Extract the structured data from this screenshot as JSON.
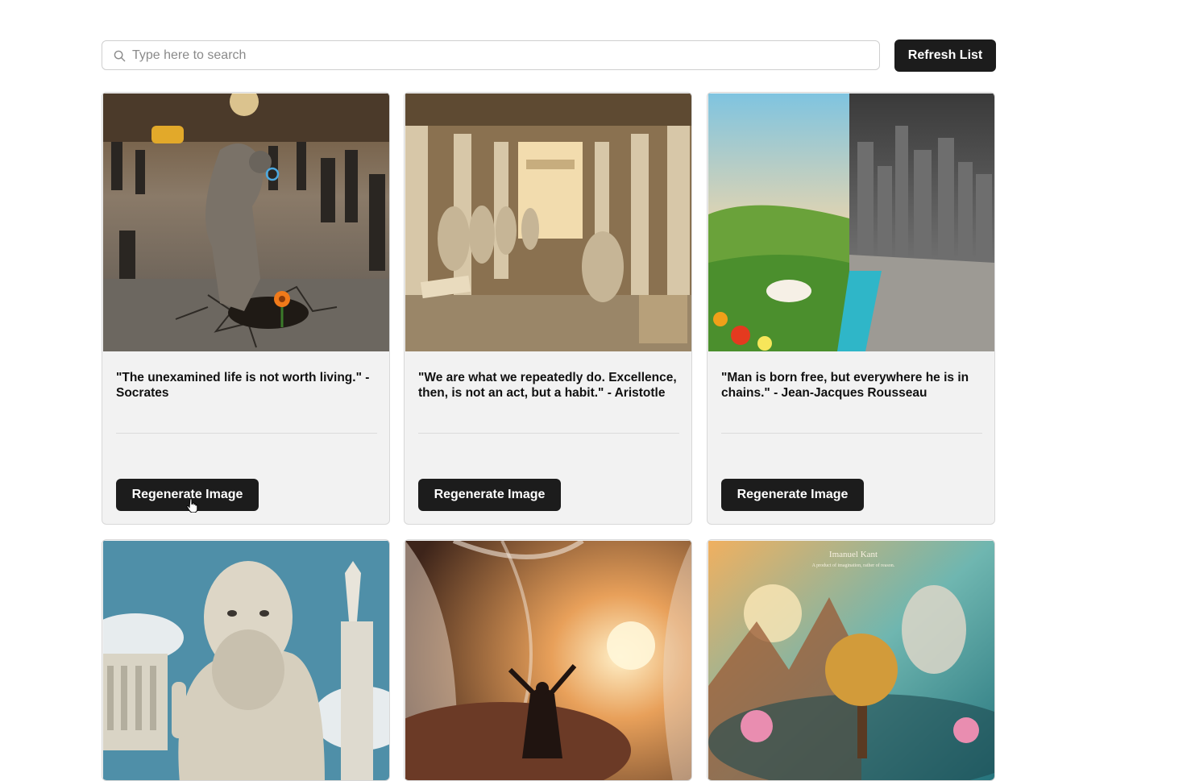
{
  "search": {
    "placeholder": "Type here to search",
    "value": ""
  },
  "toolbar": {
    "refresh_label": "Refresh List"
  },
  "cards": [
    {
      "quote": "\"The unexamined life is not worth living.\" - Socrates",
      "button": "Regenerate Image",
      "image": "philosopher-in-crowd-with-flower-image"
    },
    {
      "quote": "\"We are what we repeatedly do. Excellence, then, is not an act, but a habit.\" - Aristotle",
      "button": "Regenerate Image",
      "image": "scribes-hall-image"
    },
    {
      "quote": "\"Man is born free, but everywhere he is in chains.\" - Jean-Jacques Rousseau",
      "button": "Regenerate Image",
      "image": "nature-vs-city-image"
    },
    {
      "quote": "",
      "button": "",
      "image": "greek-philosopher-portrait-image"
    },
    {
      "quote": "",
      "button": "",
      "image": "figure-before-veils-image"
    },
    {
      "quote": "",
      "button": "",
      "image": "kant-dreamscape-image"
    }
  ],
  "overlays": {
    "kant_title": "Imanuel Kant",
    "kant_sub": "A product of imagination, rather of reason."
  },
  "colors": {
    "button_bg": "#1c1c1c",
    "card_bg": "#f2f2f2"
  }
}
